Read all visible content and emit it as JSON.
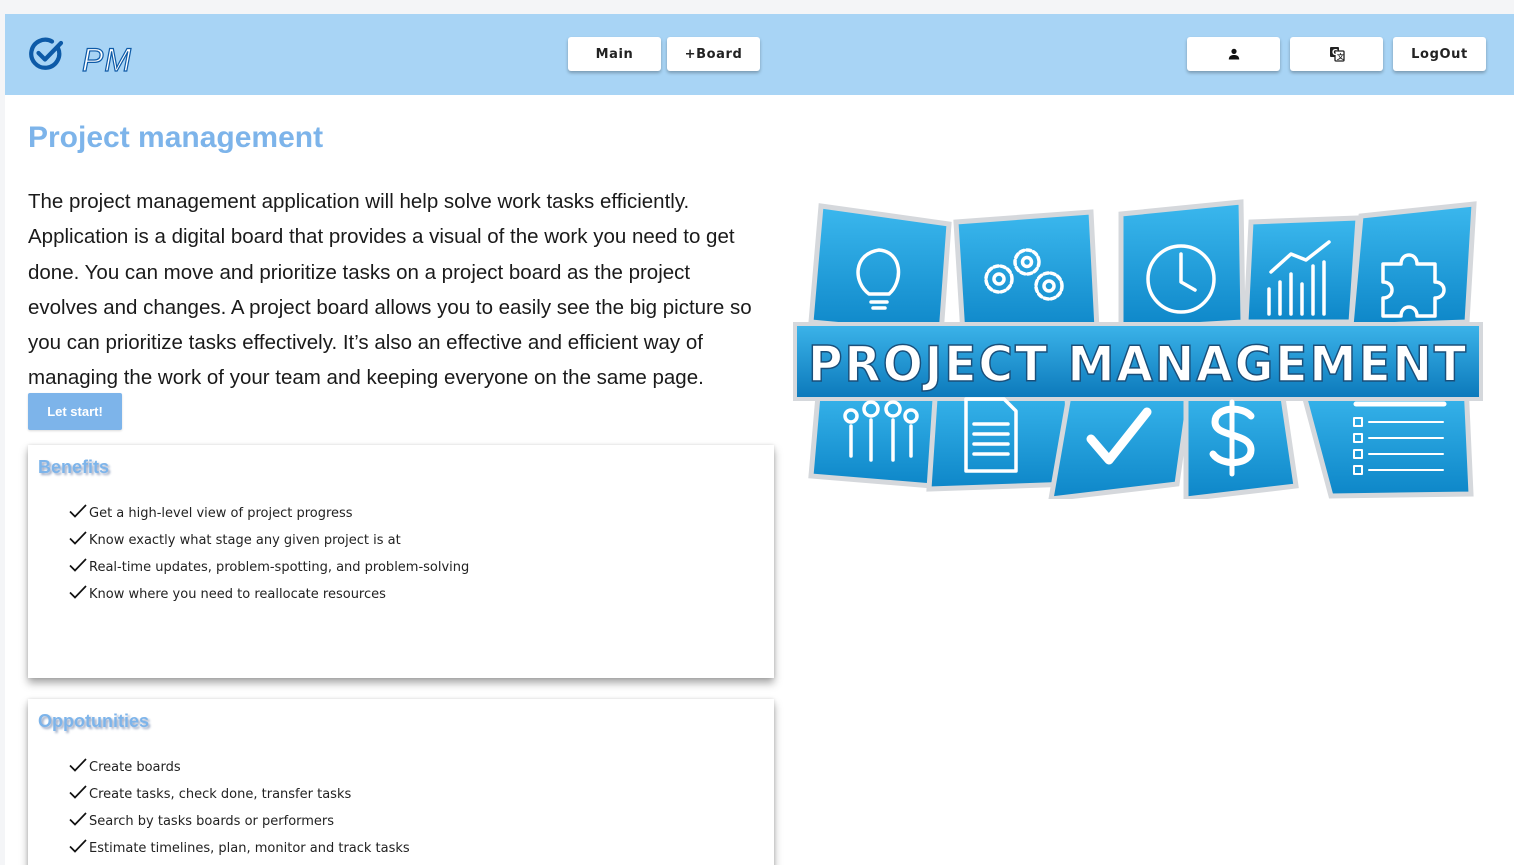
{
  "header": {
    "logo_text": "PM",
    "nav": {
      "main": "Main",
      "board": "+Board"
    },
    "actions": {
      "profile_icon": "person-icon",
      "lang_icon": "translate-icon",
      "logout": "LogOut"
    }
  },
  "main": {
    "title": "Project management",
    "intro": "The project management application will help solve work tasks efficiently. Application is a digital board that provides a visual of the work you need to get done. You can move and prioritize tasks on a project board as the project evolves and changes. A project board allows you to easily see the big picture so you can prioritize tasks effectively. It’s also an effective and efficient way of managing the work of your team and keeping everyone on the same page.",
    "start_button": "Let start!"
  },
  "benefits": {
    "title": "Benefits",
    "items": [
      "Get a high-level view of project progress",
      "Know exactly what stage any given project is at",
      "Real-time updates, problem-spotting, and problem-solving",
      "Know where you need to reallocate resources"
    ]
  },
  "opportunities": {
    "title": "Oppotunities",
    "items": [
      "Create boards",
      "Create tasks, check done, transfer tasks",
      "Search by tasks boards or performers",
      "Estimate timelines, plan, monitor and track tasks"
    ]
  },
  "banner": {
    "text": "PROJECT MANAGEMENT"
  },
  "colors": {
    "header": "#a8d4f5",
    "accent": "#7db4ea",
    "banner_blue": "#1fa3e0",
    "logo_blue": "#0d5aa7"
  }
}
